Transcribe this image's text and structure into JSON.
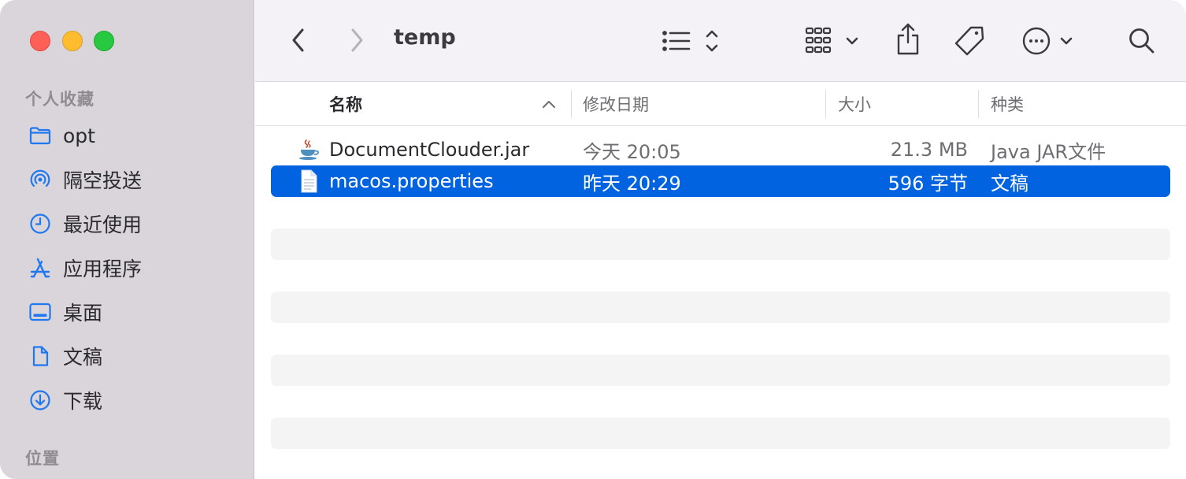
{
  "window": {
    "title": "temp"
  },
  "sidebar": {
    "favorites_title": "个人收藏",
    "location_title": "位置",
    "items": [
      {
        "label": "opt",
        "icon": "folder-icon"
      },
      {
        "label": "隔空投送",
        "icon": "airdrop-icon"
      },
      {
        "label": "最近使用",
        "icon": "clock-icon"
      },
      {
        "label": "应用程序",
        "icon": "applications-icon"
      },
      {
        "label": "桌面",
        "icon": "desktop-icon"
      },
      {
        "label": "文稿",
        "icon": "document-icon"
      },
      {
        "label": "下载",
        "icon": "download-icon"
      }
    ]
  },
  "columns": {
    "name": "名称",
    "modified": "修改日期",
    "size": "大小",
    "kind": "种类"
  },
  "files": [
    {
      "name": "DocumentClouder.jar",
      "modified": "今天 20:05",
      "size": "21.3 MB",
      "kind": "Java JAR文件",
      "icon": "java-jar-icon",
      "selected": false
    },
    {
      "name": "macos.properties",
      "modified": "昨天 20:29",
      "size": "596 字节",
      "kind": "文稿",
      "icon": "text-file-icon",
      "selected": true
    }
  ],
  "colors": {
    "accent": "#0163e0",
    "sidebar_icon": "#1f78f0",
    "sidebar_bg": "#d9d5da"
  }
}
